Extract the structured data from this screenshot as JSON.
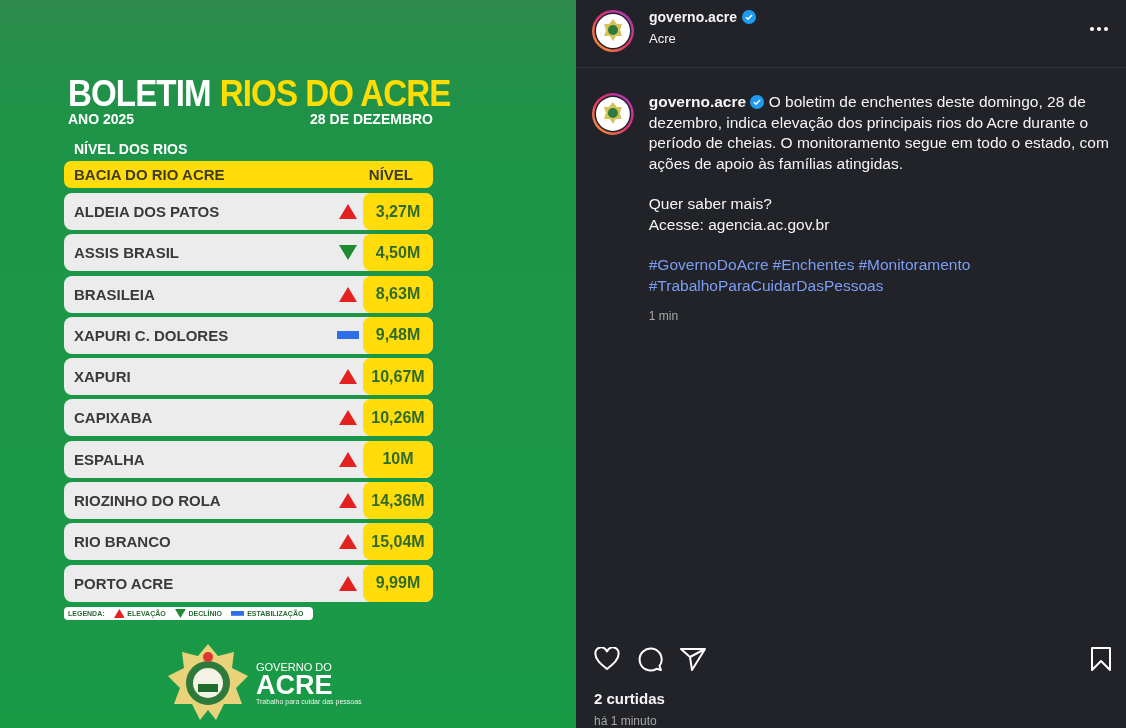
{
  "post_image": {
    "title_white": "BOLETIM",
    "title_yellow": "RIOS DO ACRE",
    "year": "ANO 2025",
    "date": "28 DE DEZEMBRO",
    "section": "NÍVEL DOS RIOS",
    "header": {
      "basin": "BACIA DO RIO ACRE",
      "level": "NÍVEL"
    },
    "rivers": [
      {
        "name": "ALDEIA DOS PATOS",
        "kind": "rise",
        "value": "3,27M"
      },
      {
        "name": "ASSIS BRASIL",
        "kind": "decline",
        "value": "4,50M"
      },
      {
        "name": "BRASILEIA",
        "kind": "rise",
        "value": "8,63M"
      },
      {
        "name": "XAPURI C. DOLORES",
        "kind": "stable",
        "value": "9,48M"
      },
      {
        "name": "XAPURI",
        "kind": "rise",
        "value": "10,67M"
      },
      {
        "name": "CAPIXABA",
        "kind": "rise",
        "value": "10,26M"
      },
      {
        "name": "ESPALHA",
        "kind": "rise",
        "value": "10M"
      },
      {
        "name": "RIOZINHO DO ROLA",
        "kind": "rise",
        "value": "14,36M"
      },
      {
        "name": "RIO BRANCO",
        "kind": "rise",
        "value": "15,04M"
      },
      {
        "name": "PORTO ACRE",
        "kind": "rise",
        "value": "9,99M"
      }
    ],
    "legend": {
      "title": "LEGENDA:",
      "items": [
        {
          "kind": "rise",
          "label": "ELEVAÇÃO"
        },
        {
          "kind": "decline",
          "label": "DECLÍNIO"
        },
        {
          "kind": "stable",
          "label": "ESTABILIZAÇÃO"
        }
      ]
    },
    "brand": {
      "line1": "GOVERNO DO",
      "line2": "ACRE",
      "tagline": "Trabalho para cuidar das pessoas"
    }
  },
  "post_header": {
    "username": "governo.acre",
    "verified": true,
    "location": "Acre"
  },
  "caption": {
    "username": "governo.acre",
    "verified": true,
    "text": "O boletim de enchentes deste domingo, 28 de dezembro, indica elevação dos principais rios do Acre durante o período de cheias. O monitoramento segue em todo o estado, com ações de apoio às famílias atingidas.",
    "more": [
      "Quer saber mais?",
      "Acesse: agencia.ac.gov.br"
    ],
    "hashtags": [
      "#GovernoDoAcre",
      "#Enchentes",
      "#Monitoramento",
      "#TrabalhoParaCuidarDasPessoas"
    ],
    "time": "1 min"
  },
  "likes": "2 curtidas",
  "posted": "há 1 minuto"
}
